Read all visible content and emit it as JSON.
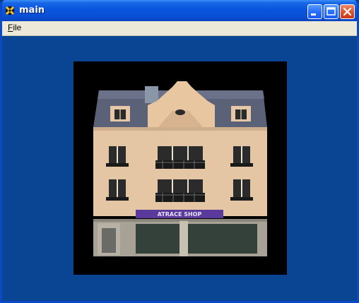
{
  "window": {
    "title": "main",
    "app_icon": "app-logo-icon",
    "controls": {
      "minimize": "minimize-icon",
      "maximize": "maximize-icon",
      "close": "close-icon"
    }
  },
  "menubar": {
    "items": [
      {
        "label_first": "F",
        "label_rest": "ile"
      }
    ]
  },
  "scene": {
    "sign_text": "ATRACE SHOP"
  },
  "colors": {
    "title_bar": "#0a55dd",
    "client_background": "#0a4593",
    "menu_background": "#ece9d8",
    "render_background": "#000000",
    "sign": "#5a3a9a"
  }
}
